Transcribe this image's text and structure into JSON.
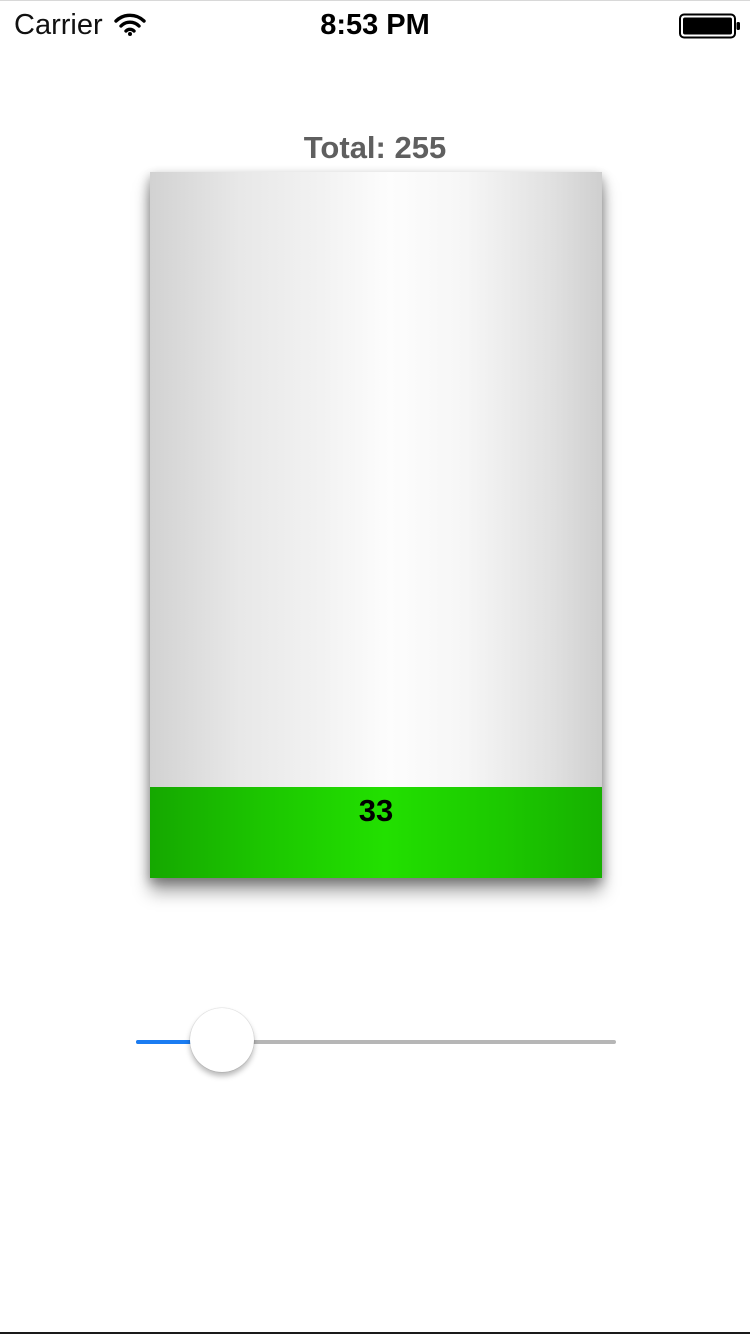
{
  "status_bar": {
    "carrier": "Carrier",
    "time": "8:53 PM",
    "wifi_icon": "wifi-icon",
    "battery_icon": "battery-full-icon"
  },
  "gauge": {
    "total_label": "Total: 255",
    "total": 255,
    "value": 33,
    "value_label": "33",
    "fill_color": "#1ccc00"
  },
  "slider": {
    "value": 33,
    "min": 0,
    "max": 255,
    "fill_color": "#1a7cf2",
    "track_color": "#b6b6b6"
  }
}
